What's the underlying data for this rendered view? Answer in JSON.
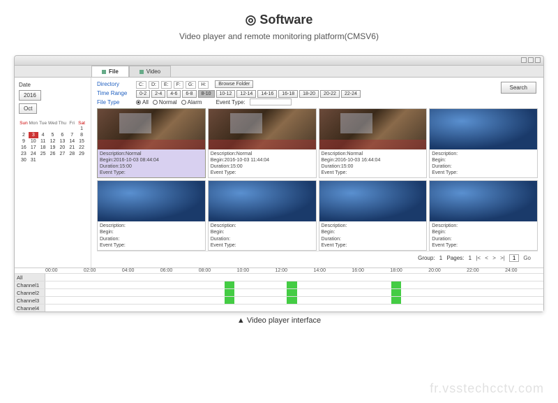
{
  "header": {
    "title": "◎ Software",
    "subtitle": "Video player and remote monitoring platform(CMSV6)"
  },
  "tabs": {
    "file": "File",
    "video": "Video"
  },
  "sidebar": {
    "dateLabel": "Date",
    "yearBtn": "2016",
    "monthBtn": "Oct",
    "weekdays": [
      "Sun",
      "Mon",
      "Tue",
      "Wed",
      "Thu",
      "Fri",
      "Sat"
    ],
    "days": [
      "",
      "",
      "",
      "",
      "",
      "",
      "1",
      "2",
      "3",
      "4",
      "5",
      "6",
      "7",
      "8",
      "9",
      "10",
      "11",
      "12",
      "13",
      "14",
      "15",
      "16",
      "17",
      "18",
      "19",
      "20",
      "21",
      "22",
      "23",
      "24",
      "25",
      "26",
      "27",
      "28",
      "29",
      "30",
      "31",
      "",
      "",
      "",
      "",
      ""
    ],
    "selectedDay": "3"
  },
  "filters": {
    "dirLabel": "Directory",
    "dirs": [
      "C:",
      "D:",
      "E:",
      "F:",
      "G:",
      "H:"
    ],
    "browse": "Browse Folder",
    "timeLabel": "Time Range",
    "timeRanges": [
      "0-2",
      "2-4",
      "4-6",
      "6-8",
      "8-10",
      "10-12",
      "12-14",
      "14-16",
      "16-18",
      "18-20",
      "20-22",
      "22-24"
    ],
    "fileTypeLabel": "File Type",
    "fileTypes": [
      "All",
      "Normal",
      "Alarm"
    ],
    "eventTypeLabel": "Event Type:",
    "search": "Search"
  },
  "clips": [
    {
      "desc": "Description:Normal",
      "begin": "Begin:2016-10-03 08:44:04",
      "dur": "Duration:15:00",
      "evt": "Event Type:",
      "kind": "bus",
      "sel": true
    },
    {
      "desc": "Description:Normal",
      "begin": "Begin:2016-10-03 11:44:04",
      "dur": "Duration:15:00",
      "evt": "Event Type:",
      "kind": "bus"
    },
    {
      "desc": "Description:Normal",
      "begin": "Begin:2016-10-03 16:44:04",
      "dur": "Duration:15:00",
      "evt": "Event Type:",
      "kind": "bus"
    },
    {
      "desc": "Description:",
      "begin": "Begin:",
      "dur": "Duration:",
      "evt": "Event Type:",
      "kind": "blue"
    },
    {
      "desc": "Description:",
      "begin": "Begin:",
      "dur": "Duration:",
      "evt": "Event Type:",
      "kind": "blue"
    },
    {
      "desc": "Description:",
      "begin": "Begin:",
      "dur": "Duration:",
      "evt": "Event Type:",
      "kind": "blue"
    },
    {
      "desc": "Description:",
      "begin": "Begin:",
      "dur": "Duration:",
      "evt": "Event Type:",
      "kind": "blue"
    },
    {
      "desc": "Description:",
      "begin": "Begin:",
      "dur": "Duration:",
      "evt": "Event Type:",
      "kind": "blue"
    }
  ],
  "pagination": {
    "group": "Group:",
    "groupVal": "1",
    "pages": "Pages:",
    "pageVal": "1",
    "go": "Go"
  },
  "timeline": {
    "hours": [
      "00:00",
      "02:00",
      "04:00",
      "06:00",
      "08:00",
      "10:00",
      "12:00",
      "14:00",
      "16:00",
      "18:00",
      "20:00",
      "22:00",
      "24:00"
    ],
    "rows": [
      {
        "label": "All",
        "segs": []
      },
      {
        "label": "Channel1",
        "segs": [
          {
            "l": 36,
            "w": 2
          },
          {
            "l": 48.5,
            "w": 2
          },
          {
            "l": 69.5,
            "w": 2
          }
        ]
      },
      {
        "label": "Channel2",
        "segs": [
          {
            "l": 36,
            "w": 2
          },
          {
            "l": 48.5,
            "w": 2
          },
          {
            "l": 69.5,
            "w": 2
          }
        ]
      },
      {
        "label": "Channel3",
        "segs": [
          {
            "l": 36,
            "w": 2
          },
          {
            "l": 48.5,
            "w": 2
          },
          {
            "l": 69.5,
            "w": 2
          }
        ]
      },
      {
        "label": "Channel4",
        "segs": []
      }
    ]
  },
  "footer": "▲ Video player interface",
  "watermark": "fr.vsstechcctv.com"
}
